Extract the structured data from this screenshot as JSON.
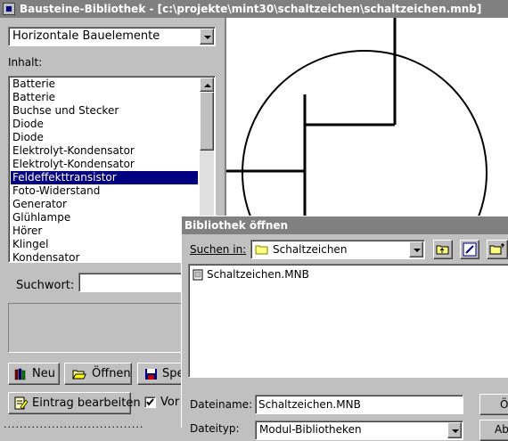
{
  "main": {
    "title": "Bausteine-Bibliothek - [c:\\projekte\\mint30\\schaltzeichen\\schaltzeichen.mnb]",
    "category_value": "Horizontale Bauelemente",
    "content_label": "Inhalt:",
    "items": [
      "Batterie",
      "Batterie",
      "Buchse und Stecker",
      "Diode",
      "Diode",
      "Elektrolyt-Kondensator",
      "Elektrolyt-Kondensator",
      "Feldeffekttransistor",
      "Foto-Widerstand",
      "Generator",
      "Glühlampe",
      "Hörer",
      "Klingel",
      "Kondensator"
    ],
    "selected_item": "Feldeffekttransistor",
    "search_label": "Suchwort:",
    "search_value": "",
    "buttons": {
      "new": "Neu",
      "open": "Öffnen",
      "save": "Spe",
      "edit": "Eintrag bearbeiten"
    },
    "checkbox_label": "Vor",
    "checkbox_checked": true,
    "status_text": "..................................."
  },
  "dialog": {
    "title": "Bibliothek öffnen",
    "look_in_label": "Suchen in:",
    "look_in_value": "Schaltzeichen",
    "files": [
      "Schaltzeichen.MNB"
    ],
    "filename_label": "Dateiname:",
    "filename_value": "Schaltzeichen.MNB",
    "filetype_label": "Dateityp:",
    "filetype_value": "Modul-Bibliotheken",
    "open_button": "Öf",
    "other_button": "Ab"
  }
}
